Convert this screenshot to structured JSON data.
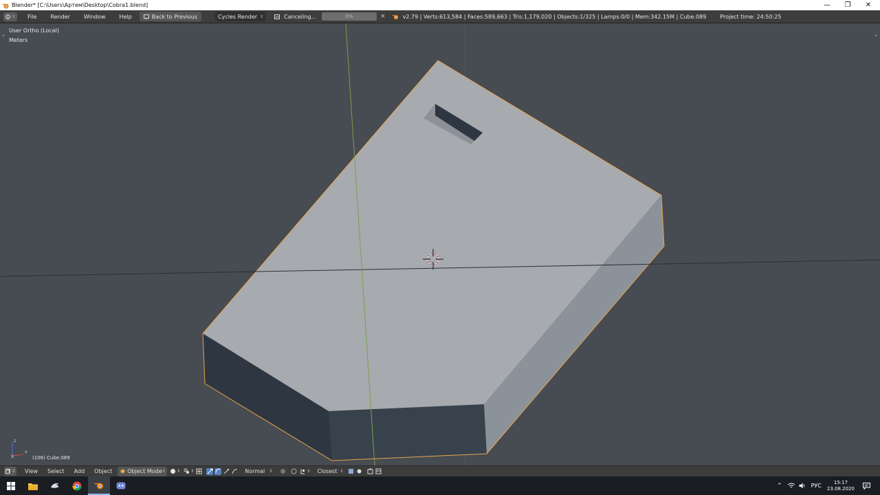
{
  "window": {
    "title": "Blender* [C:\\Users\\Артем\\Desktop\\Cobra1.blend]",
    "controls": {
      "minimize": "—",
      "maximize": "❐",
      "close": "✕"
    }
  },
  "info_header": {
    "menus": [
      "File",
      "Render",
      "Window",
      "Help"
    ],
    "back_label": "Back to Previous",
    "render_engine": "Cycles Render",
    "job_label": "Canceling...",
    "progress_text": "0%",
    "progress_value": 0,
    "cancel_symbol": "×",
    "stats": "v2.79 | Verts:613,584 | Faces:589,663 | Tris:1,179,020 | Objects:1/325 | Lamps:0/0 | Mem:342.15M | Cube.089",
    "project_time": "Project time: 24:50:25"
  },
  "viewport": {
    "view_name": "User Ortho (Local)",
    "units": "Meters",
    "object_info": "(106) Cube.089",
    "axis_labels": {
      "z": "z",
      "x": "x",
      "y": "y"
    },
    "colors": {
      "background": "#474b52",
      "selection": "#e8a54c",
      "x_axis": "#2d2f33",
      "y_axis": "#7aa04a"
    }
  },
  "view3d_header": {
    "menus": [
      "View",
      "Select",
      "Add",
      "Object"
    ],
    "mode": "Object Mode",
    "pivot": "Normal",
    "snap": "Closest"
  },
  "taskbar": {
    "language": "РУС",
    "time": "15:17",
    "date": "23.08.2020"
  }
}
